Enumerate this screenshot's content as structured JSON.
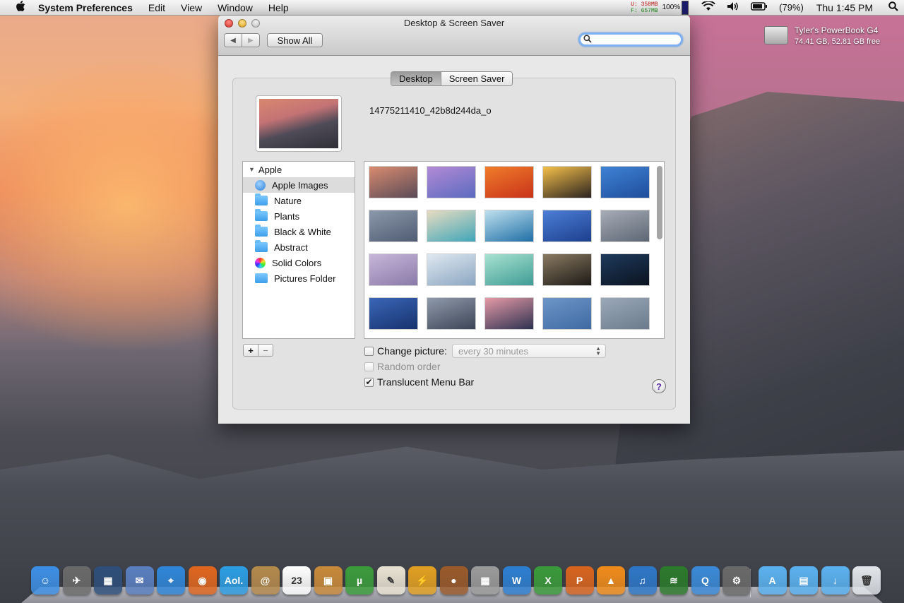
{
  "menubar": {
    "app_name": "System Preferences",
    "menus": [
      "Edit",
      "View",
      "Window",
      "Help"
    ],
    "mem_used_label": "U:",
    "mem_used": "358MB",
    "mem_free_label": "F:",
    "mem_free": "657MB",
    "cpu_pct": "100%",
    "battery": "(79%)",
    "clock": "Thu 1:45 PM",
    "icons": [
      "apple-logo-icon",
      "wifi-icon",
      "volume-icon",
      "battery-icon",
      "spotlight-search-icon"
    ]
  },
  "desktop": {
    "drive_name": "Tyler's PowerBook G4",
    "drive_info": "74.41 GB, 52.81 GB free"
  },
  "window": {
    "title": "Desktop & Screen Saver",
    "show_all": "Show All",
    "search_value": "",
    "tabs": [
      {
        "label": "Desktop",
        "selected": true
      },
      {
        "label": "Screen Saver",
        "selected": false
      }
    ],
    "current_file": "14775211410_42b8d244da_o",
    "source_list": {
      "header": "Apple",
      "items": [
        {
          "label": "Apple Images",
          "icon": "apple-icon",
          "selected": true
        },
        {
          "label": "Nature",
          "icon": "folder-icon"
        },
        {
          "label": "Plants",
          "icon": "folder-icon"
        },
        {
          "label": "Black & White",
          "icon": "folder-icon"
        },
        {
          "label": "Abstract",
          "icon": "folder-icon"
        },
        {
          "label": "Solid Colors",
          "icon": "color-wheel-icon"
        },
        {
          "label": "Pictures Folder",
          "icon": "pictures-folder-icon"
        }
      ]
    },
    "add_label": "+",
    "remove_label": "−",
    "thumbnails": [
      {
        "colors": [
          "#d98b6f",
          "#5a4b57"
        ]
      },
      {
        "colors": [
          "#b28ad6",
          "#5c6bbf"
        ]
      },
      {
        "colors": [
          "#f07d2a",
          "#c8321a"
        ]
      },
      {
        "colors": [
          "#f5c04a",
          "#2b2320"
        ]
      },
      {
        "colors": [
          "#3f82d4",
          "#1f4e9c"
        ]
      },
      {
        "colors": [
          "#8c98ab",
          "#4f5c72"
        ]
      },
      {
        "colors": [
          "#e9dcc2",
          "#3fa6b8"
        ]
      },
      {
        "colors": [
          "#bfe0ee",
          "#1f6fa6"
        ]
      },
      {
        "colors": [
          "#4c7fd6",
          "#1d3f8e"
        ]
      },
      {
        "colors": [
          "#a7adb7",
          "#5d6674"
        ]
      },
      {
        "colors": [
          "#c8b6d9",
          "#8a7aa8"
        ]
      },
      {
        "colors": [
          "#dfe8f0",
          "#8ca7c2"
        ]
      },
      {
        "colors": [
          "#a8e2d0",
          "#3f9c95"
        ]
      },
      {
        "colors": [
          "#8a7a62",
          "#1d1a16"
        ]
      },
      {
        "colors": [
          "#1e3a5c",
          "#0b1320"
        ]
      },
      {
        "colors": [
          "#3a66b7",
          "#17326e"
        ]
      },
      {
        "colors": [
          "#8f9aab",
          "#3c4556"
        ]
      },
      {
        "colors": [
          "#e59aa6",
          "#2d3150"
        ]
      },
      {
        "colors": [
          "#6d96c8",
          "#3e6aa3"
        ]
      },
      {
        "colors": [
          "#9aa8b8",
          "#6c7b8c"
        ]
      }
    ],
    "change_picture": {
      "label": "Change picture:",
      "checked": false
    },
    "interval": "every 30 minutes",
    "random_order": {
      "label": "Random order",
      "checked": false,
      "disabled": true
    },
    "translucent": {
      "label": "Translucent Menu Bar",
      "checked": true
    },
    "help": "?"
  },
  "dock": {
    "apps": [
      {
        "name": "finder-icon",
        "color": "#3d8fe6",
        "glyph": "☺"
      },
      {
        "name": "launchpad-icon",
        "color": "#6a6a6a",
        "glyph": "✈"
      },
      {
        "name": "mission-control-icon",
        "color": "#2e4f7a",
        "glyph": "▦"
      },
      {
        "name": "mail-icon",
        "color": "#5a7fc0",
        "glyph": "✉"
      },
      {
        "name": "safari-icon",
        "color": "#2f86d9",
        "glyph": "⌖"
      },
      {
        "name": "firefox-icon",
        "color": "#e0661e",
        "glyph": "◉"
      },
      {
        "name": "aol-icon",
        "color": "#2c9ee3",
        "glyph": "Aol."
      },
      {
        "name": "address-book-icon",
        "color": "#b48a4c",
        "glyph": "@"
      },
      {
        "name": "calendar-icon",
        "color": "#ffffff",
        "glyph": "23"
      },
      {
        "name": "iphoto-icon",
        "color": "#c98a3a",
        "glyph": "▣"
      },
      {
        "name": "utorrent-icon",
        "color": "#3b9c3b",
        "glyph": "µ"
      },
      {
        "name": "textedit-icon",
        "color": "#e8e2d2",
        "glyph": "✎"
      },
      {
        "name": "winamp-icon",
        "color": "#e2a021",
        "glyph": "⚡"
      },
      {
        "name": "acorn-icon",
        "color": "#9a5a2a",
        "glyph": "●"
      },
      {
        "name": "calculator-icon",
        "color": "#9b9b9b",
        "glyph": "▦"
      },
      {
        "name": "word-icon",
        "color": "#2d7fd1",
        "glyph": "W"
      },
      {
        "name": "excel-icon",
        "color": "#3a9a3a",
        "glyph": "X"
      },
      {
        "name": "powerpoint-icon",
        "color": "#d8641e",
        "glyph": "P"
      },
      {
        "name": "vlc-icon",
        "color": "#f08c1a",
        "glyph": "▲"
      },
      {
        "name": "itunes-icon",
        "color": "#2d77c8",
        "glyph": "♫"
      },
      {
        "name": "spotify-icon",
        "color": "#2b7a2b",
        "glyph": "≋"
      },
      {
        "name": "quicktime-icon",
        "color": "#3a8ad8",
        "glyph": "Q"
      },
      {
        "name": "system-preferences-icon",
        "color": "#6a6a6a",
        "glyph": "⚙"
      },
      {
        "name": "applications-folder-icon",
        "color": "#5ab2f0",
        "glyph": "A"
      },
      {
        "name": "documents-folder-icon",
        "color": "#5ab2f0",
        "glyph": "▤"
      },
      {
        "name": "downloads-folder-icon",
        "color": "#5ab2f0",
        "glyph": "↓"
      },
      {
        "name": "trash-icon",
        "color": "#e3e6ea",
        "glyph": "🗑"
      }
    ]
  }
}
